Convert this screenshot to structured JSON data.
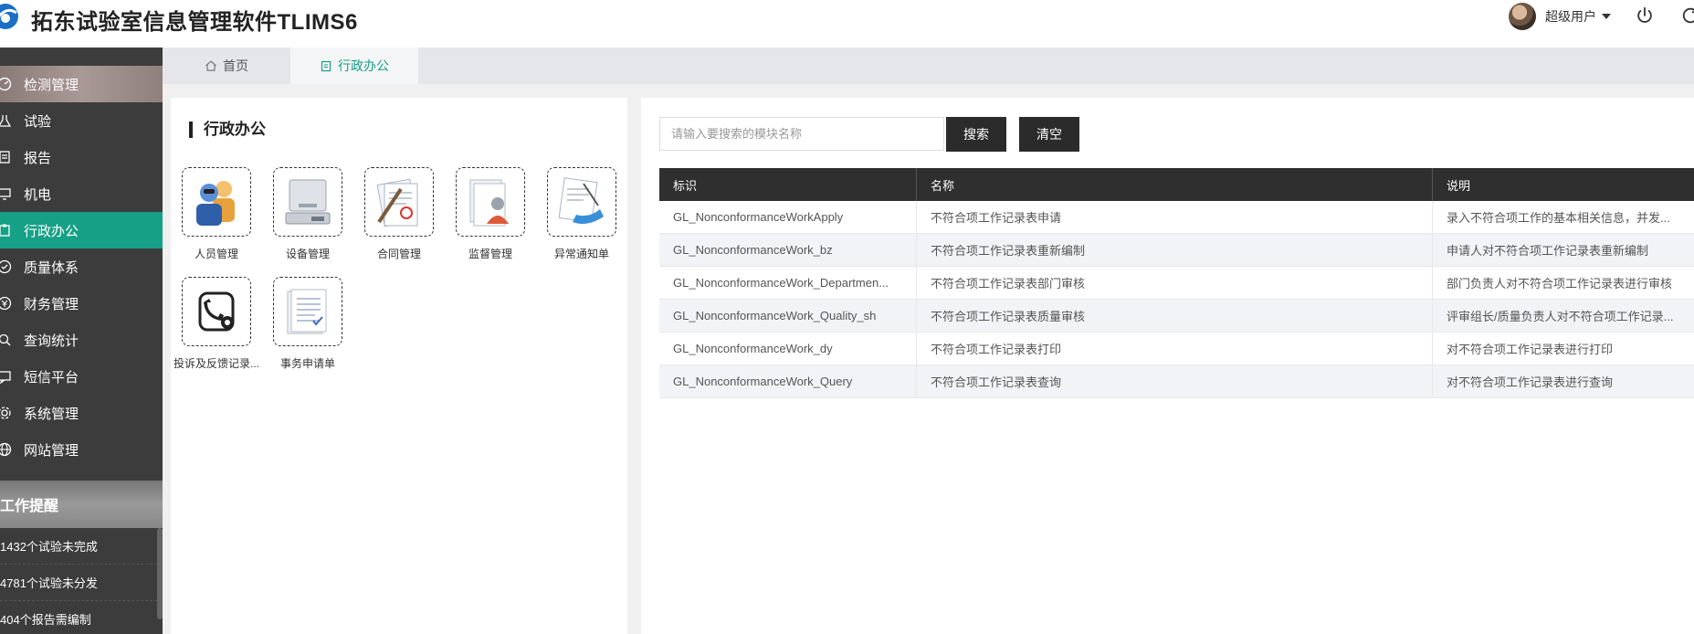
{
  "header": {
    "title": "拓东试验室信息管理软件TLIMS6",
    "user_name": "超级用户"
  },
  "sidebar": {
    "items": [
      {
        "label": "检测管理",
        "icon": "gauge-icon"
      },
      {
        "label": "试验",
        "icon": "flask-icon"
      },
      {
        "label": "报告",
        "icon": "document-icon"
      },
      {
        "label": "机电",
        "icon": "monitor-icon"
      },
      {
        "label": "行政办公",
        "icon": "clipboard-icon"
      },
      {
        "label": "质量体系",
        "icon": "check-circle-icon"
      },
      {
        "label": "财务管理",
        "icon": "money-icon"
      },
      {
        "label": "查询统计",
        "icon": "search-icon"
      },
      {
        "label": "短信平台",
        "icon": "message-icon"
      },
      {
        "label": "系统管理",
        "icon": "gear-icon"
      },
      {
        "label": "网站管理",
        "icon": "globe-icon"
      }
    ],
    "reminder_title": "工作提醒",
    "reminders": [
      "1432个试验未完成",
      "4781个试验未分发",
      "404个报告需编制"
    ]
  },
  "tabs": [
    {
      "label": "首页",
      "icon": "home-icon"
    },
    {
      "label": "行政办公",
      "icon": "clipboard-icon"
    }
  ],
  "left_panel": {
    "title": "行政办公",
    "modules": [
      {
        "label": "人员管理",
        "icon": "people-icon"
      },
      {
        "label": "设备管理",
        "icon": "balance-icon"
      },
      {
        "label": "合同管理",
        "icon": "contract-icon"
      },
      {
        "label": "监督管理",
        "icon": "supervisor-icon"
      },
      {
        "label": "异常通知单",
        "icon": "notice-icon"
      },
      {
        "label": "投诉及反馈记录...",
        "icon": "phone-gear-icon"
      },
      {
        "label": "事务申请单",
        "icon": "form-icon"
      }
    ]
  },
  "right_panel": {
    "search_placeholder": "请输入要搜索的模块名称",
    "search_button": "搜索",
    "clear_button": "清空",
    "columns": [
      "标识",
      "名称",
      "说明"
    ],
    "rows": [
      [
        "GL_NonconformanceWorkApply",
        "不符合项工作记录表申请",
        "录入不符合项工作的基本相关信息，并发..."
      ],
      [
        "GL_NonconformanceWork_bz",
        "不符合项工作记录表重新编制",
        "申请人对不符合项工作记录表重新编制"
      ],
      [
        "GL_NonconformanceWork_Departmen...",
        "不符合项工作记录表部门审核",
        "部门负责人对不符合项工作记录表进行审核"
      ],
      [
        "GL_NonconformanceWork_Quality_sh",
        "不符合项工作记录表质量审核",
        "评审组长/质量负责人对不符合项工作记录..."
      ],
      [
        "GL_NonconformanceWork_dy",
        "不符合项工作记录表打印",
        "对不符合项工作记录表进行打印"
      ],
      [
        "GL_NonconformanceWork_Query",
        "不符合项工作记录表查询",
        "对不符合项工作记录表进行查询"
      ]
    ]
  },
  "colors": {
    "accent": "#16a085",
    "sidebar_bg": "#3c3c3c",
    "table_header_bg": "#2f2f2f"
  }
}
